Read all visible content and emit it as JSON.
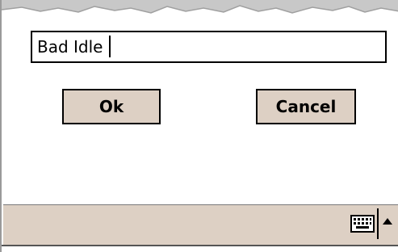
{
  "dialog": {
    "input": {
      "value": "Bad Idle"
    },
    "buttons": {
      "ok_label": "Ok",
      "cancel_label": "Cancel"
    }
  },
  "taskbar": {
    "icons": [
      "keyboard-icon",
      "up-arrow-icon"
    ]
  },
  "colors": {
    "button_bg": "#ddd0c4",
    "bar_bg": "#ddd0c4",
    "border": "#000000",
    "background": "#ffffff"
  }
}
